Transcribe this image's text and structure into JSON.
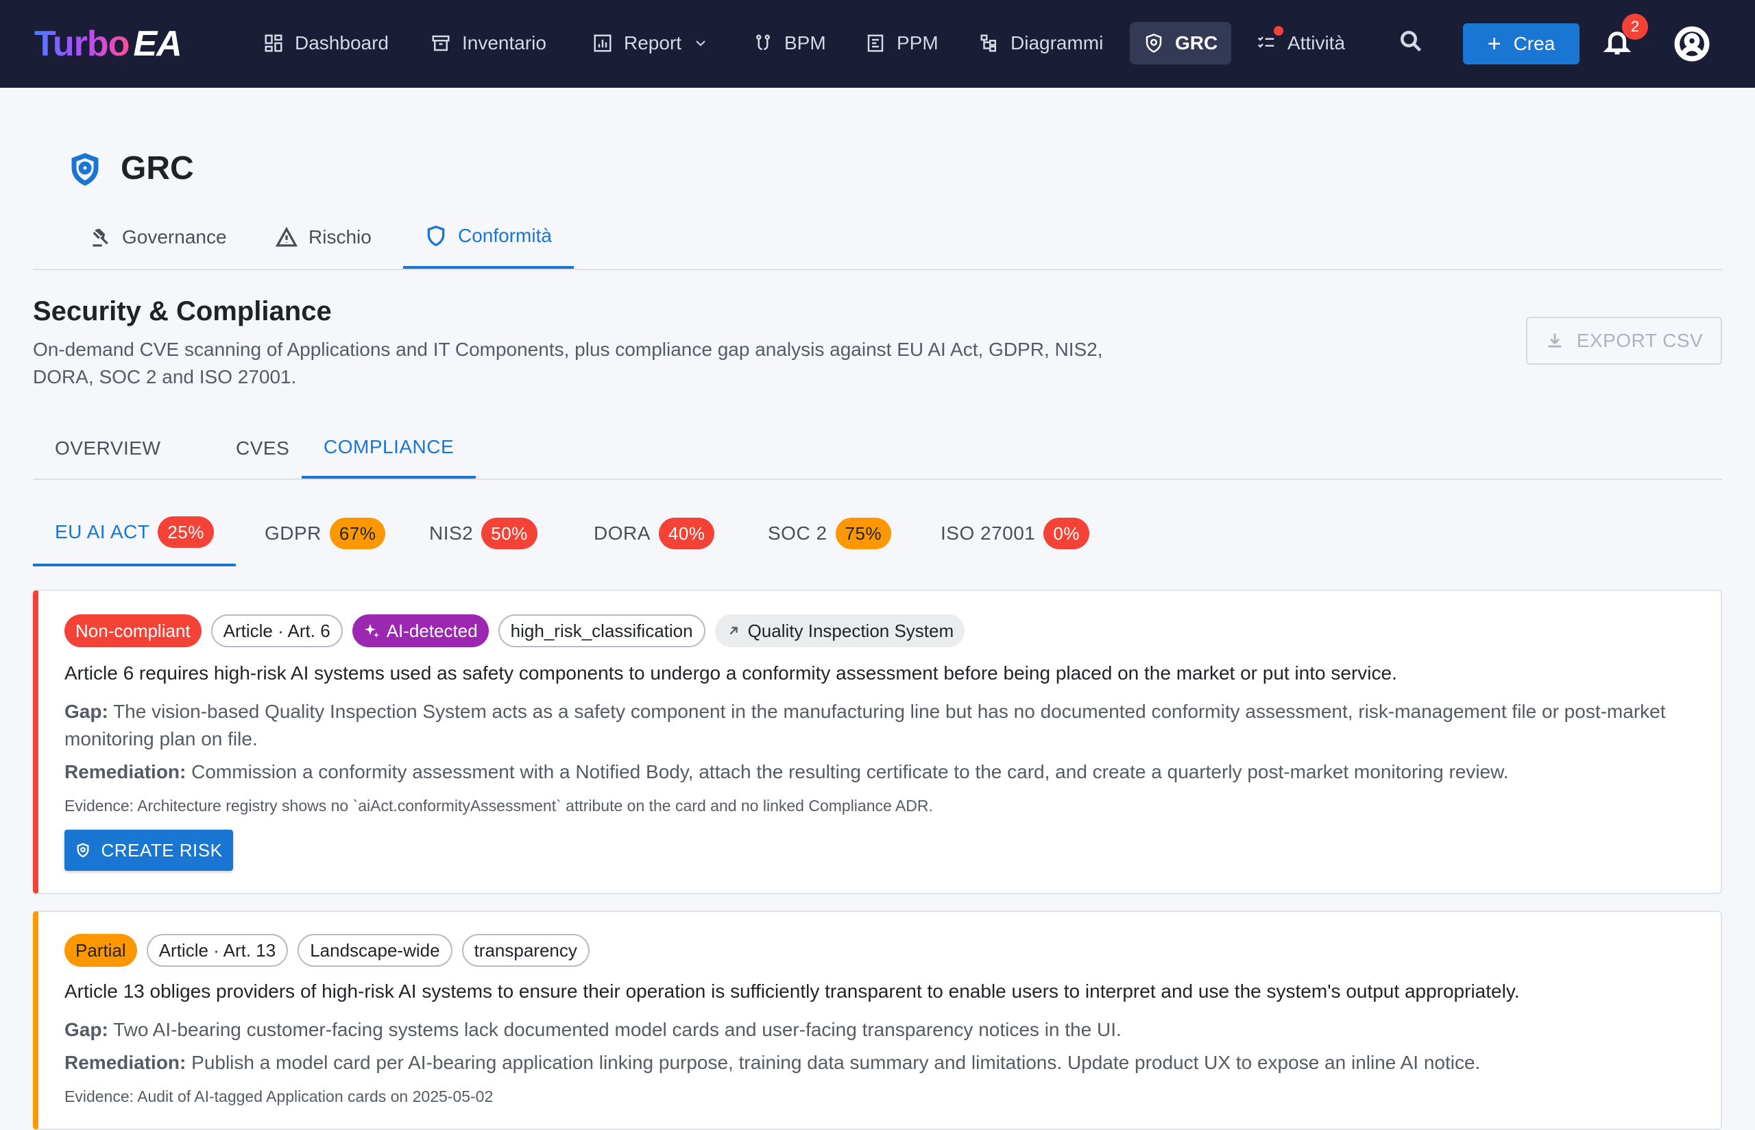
{
  "app": {
    "logo_main": "Turbo",
    "logo_suffix": "EA"
  },
  "nav": {
    "items": [
      {
        "label": "Dashboard",
        "icon": "dashboard-icon"
      },
      {
        "label": "Inventario",
        "icon": "archive-icon"
      },
      {
        "label": "Report",
        "icon": "report-icon"
      },
      {
        "label": "BPM",
        "icon": "process-icon"
      },
      {
        "label": "PPM",
        "icon": "ppm-icon"
      },
      {
        "label": "Diagrammi",
        "icon": "diagram-icon"
      },
      {
        "label": "GRC",
        "icon": "shield-icon",
        "active": true
      },
      {
        "label": "Attività",
        "icon": "checklist-icon"
      }
    ],
    "create_label": "Crea",
    "notification_count": "2"
  },
  "page": {
    "title": "GRC",
    "tabs": [
      {
        "label": "Governance",
        "icon": "gavel-icon"
      },
      {
        "label": "Rischio",
        "icon": "warning-icon"
      },
      {
        "label": "Conformità",
        "icon": "shield-outline-icon",
        "active": true
      }
    ]
  },
  "section": {
    "title": "Security & Compliance",
    "description": "On-demand CVE scanning of Applications and IT Components, plus compliance gap analysis against EU AI Act, GDPR, NIS2, DORA, SOC 2 and ISO 27001.",
    "export_label": "EXPORT CSV",
    "tabs": [
      {
        "label": "OVERVIEW"
      },
      {
        "label": "CVES"
      },
      {
        "label": "COMPLIANCE",
        "active": true
      }
    ]
  },
  "frameworks": [
    {
      "label": "EU AI ACT",
      "score": "25%",
      "tone": "red",
      "active": true
    },
    {
      "label": "GDPR",
      "score": "67%",
      "tone": "orange"
    },
    {
      "label": "NIS2",
      "score": "50%",
      "tone": "red"
    },
    {
      "label": "DORA",
      "score": "40%",
      "tone": "red"
    },
    {
      "label": "SOC 2",
      "score": "75%",
      "tone": "orange"
    },
    {
      "label": "ISO 27001",
      "score": "0%",
      "tone": "red"
    }
  ],
  "findings": [
    {
      "status": "Non-compliant",
      "article": "Article · Art. 6",
      "source": "AI-detected",
      "category": "high_risk_classification",
      "card": "Quality Inspection System",
      "requirement": "Article 6 requires high-risk AI systems used as safety components to undergo a conformity assessment before being placed on the market or put into service.",
      "gap_label": "Gap:",
      "gap": "The vision-based Quality Inspection System acts as a safety component in the manufacturing line but has no documented conformity assessment, risk-management file or post-market monitoring plan on file.",
      "remediation_label": "Remediation:",
      "remediation": "Commission a conformity assessment with a Notified Body, attach the resulting certificate to the card, and create a quarterly post-market monitoring review.",
      "evidence": "Evidence: Architecture registry shows no `aiAct.conformityAssessment` attribute on the card and no linked Compliance ADR.",
      "action_label": "CREATE RISK"
    },
    {
      "status": "Partial",
      "article": "Article · Art. 13",
      "scope": "Landscape-wide",
      "category": "transparency",
      "requirement": "Article 13 obliges providers of high-risk AI systems to ensure their operation is sufficiently transparent to enable users to interpret and use the system's output appropriately.",
      "gap_label": "Gap:",
      "gap": "Two AI-bearing customer-facing systems lack documented model cards and user-facing transparency notices in the UI.",
      "remediation_label": "Remediation:",
      "remediation": "Publish a model card per AI-bearing application linking purpose, training data summary and limitations. Update product UX to expose an inline AI notice.",
      "evidence": "Evidence: Audit of AI-tagged Application cards on 2025-05-02"
    }
  ]
}
